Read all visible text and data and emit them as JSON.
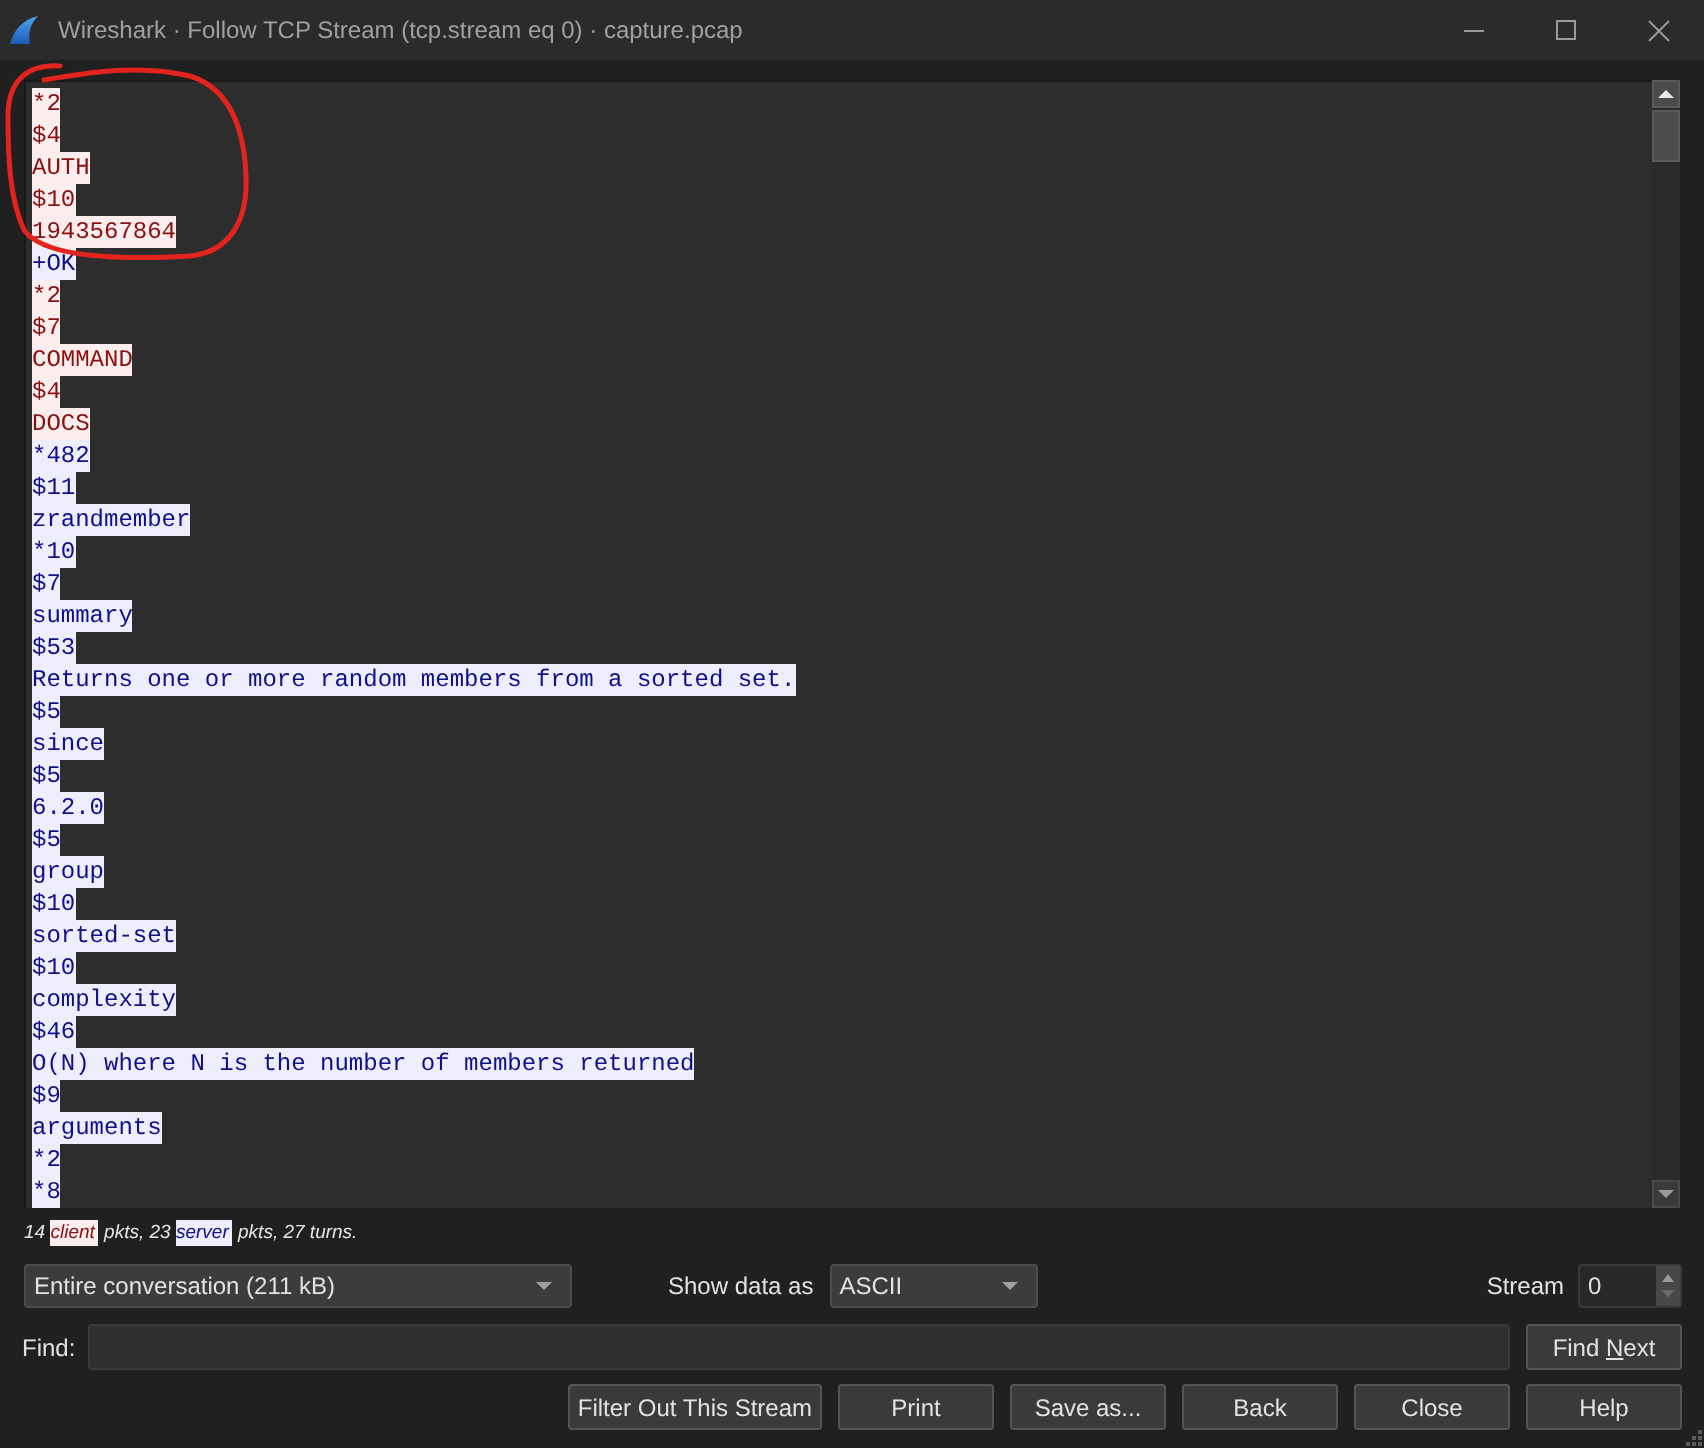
{
  "window": {
    "title": "Wireshark · Follow TCP Stream (tcp.stream eq 0) · capture.pcap"
  },
  "stream_lines": [
    {
      "kind": "client",
      "text": "*2"
    },
    {
      "kind": "client",
      "text": "$4"
    },
    {
      "kind": "client",
      "text": "AUTH"
    },
    {
      "kind": "client",
      "text": "$10"
    },
    {
      "kind": "client",
      "text": "1943567864"
    },
    {
      "kind": "server",
      "text": "+OK"
    },
    {
      "kind": "client",
      "text": "*2"
    },
    {
      "kind": "client",
      "text": "$7"
    },
    {
      "kind": "client",
      "text": "COMMAND"
    },
    {
      "kind": "client",
      "text": "$4"
    },
    {
      "kind": "client",
      "text": "DOCS"
    },
    {
      "kind": "server",
      "text": "*482"
    },
    {
      "kind": "server",
      "text": "$11"
    },
    {
      "kind": "server",
      "text": "zrandmember"
    },
    {
      "kind": "server",
      "text": "*10"
    },
    {
      "kind": "server",
      "text": "$7"
    },
    {
      "kind": "server",
      "text": "summary"
    },
    {
      "kind": "server",
      "text": "$53"
    },
    {
      "kind": "server",
      "text": "Returns one or more random members from a sorted set."
    },
    {
      "kind": "server",
      "text": "$5"
    },
    {
      "kind": "server",
      "text": "since"
    },
    {
      "kind": "server",
      "text": "$5"
    },
    {
      "kind": "server",
      "text": "6.2.0"
    },
    {
      "kind": "server",
      "text": "$5"
    },
    {
      "kind": "server",
      "text": "group"
    },
    {
      "kind": "server",
      "text": "$10"
    },
    {
      "kind": "server",
      "text": "sorted-set"
    },
    {
      "kind": "server",
      "text": "$10"
    },
    {
      "kind": "server",
      "text": "complexity"
    },
    {
      "kind": "server",
      "text": "$46"
    },
    {
      "kind": "server",
      "text": "O(N) where N is the number of members returned"
    },
    {
      "kind": "server",
      "text": "$9"
    },
    {
      "kind": "server",
      "text": "arguments"
    },
    {
      "kind": "server",
      "text": "*2"
    },
    {
      "kind": "server",
      "text": "*8"
    }
  ],
  "summary": {
    "parts": [
      {
        "kind": "plain",
        "text": "14"
      },
      {
        "kind": "client",
        "text": "client"
      },
      {
        "kind": "plain",
        "text": "pkts, 23"
      },
      {
        "kind": "server",
        "text": "server"
      },
      {
        "kind": "plain",
        "text": "pkts, 27 turns."
      }
    ]
  },
  "conversation_select": {
    "value": "Entire conversation (211 kB)"
  },
  "show_data_as": {
    "label": "Show data as",
    "value": "ASCII"
  },
  "stream": {
    "label": "Stream",
    "value": "0"
  },
  "find": {
    "label": "Find:"
  },
  "find_next": {
    "label_parts": [
      {
        "text": "Find ",
        "underlined": false
      },
      {
        "text": "N",
        "underlined": true
      },
      {
        "text": "ext",
        "underlined": false
      }
    ]
  },
  "buttons": [
    {
      "label": "Filter Out This Stream"
    },
    {
      "label": "Print"
    },
    {
      "label": "Save as..."
    },
    {
      "label": "Back"
    },
    {
      "label": "Close"
    },
    {
      "label": "Help"
    }
  ]
}
